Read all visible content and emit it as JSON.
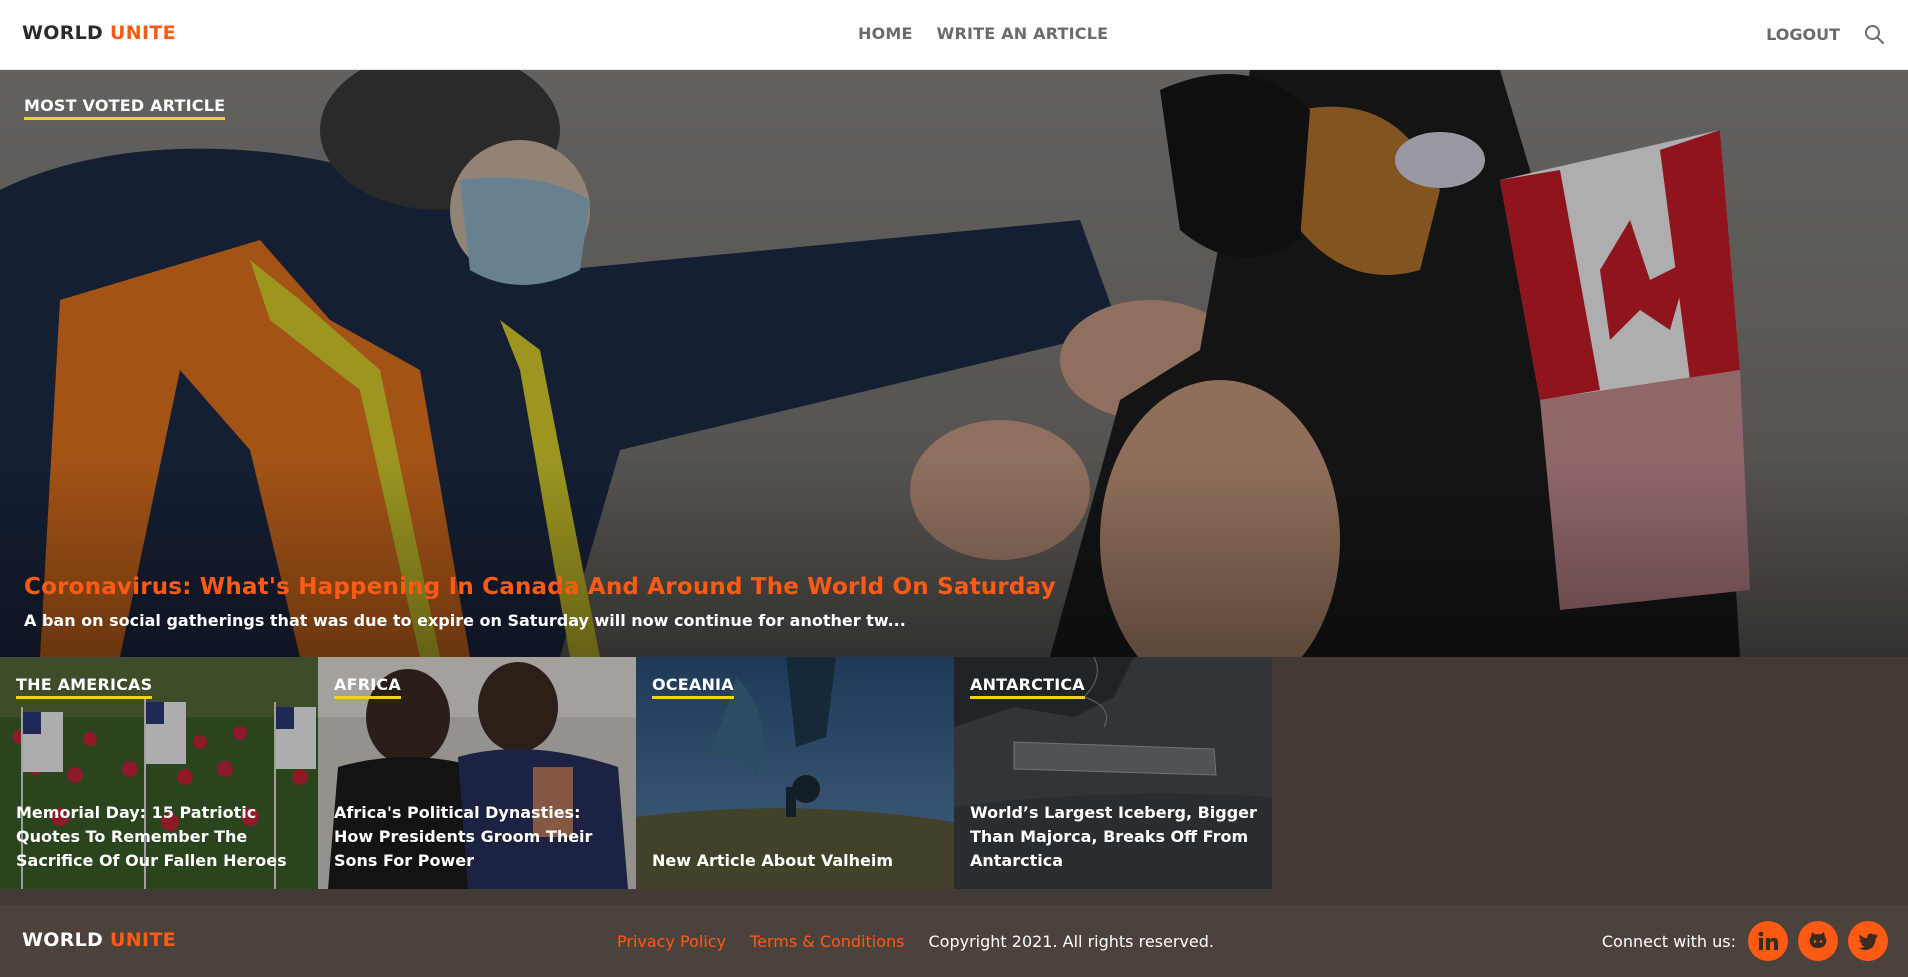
{
  "header": {
    "brand_part1": "WORLD",
    "brand_part2": "UNITE",
    "nav": [
      "HOME",
      "WRITE AN ARTICLE"
    ],
    "logout_label": "LOGOUT",
    "search_icon": "search-icon"
  },
  "hero": {
    "section_label": "MOST VOTED ARTICLE",
    "title": "Coronavirus: What's Happening In Canada And Around The World On Saturday",
    "excerpt": "A ban on social gatherings that was due to expire on Saturday will now continue for another tw..."
  },
  "regions": [
    {
      "category": "THE AMERICAS",
      "title": "Memorial Day: 15 Patriotic Quotes To Remember The Sacrifice Of Our Fallen Heroes"
    },
    {
      "category": "AFRICA",
      "title": "Africa's Political Dynasties: How Presidents Groom Their Sons For Power"
    },
    {
      "category": "OCEANIA",
      "title": "New Article About Valheim"
    },
    {
      "category": "ANTARCTICA",
      "title": "World’s Largest Iceberg, Bigger Than Majorca, Breaks Off From Antarctica"
    }
  ],
  "footer": {
    "brand_part1": "WORLD",
    "brand_part2": "UNITE",
    "privacy_label": "Privacy Policy",
    "terms_label": "Terms & Conditions",
    "copyright": "Copyright 2021. All rights reserved.",
    "connect_label": "Connect with us:",
    "social_icons": [
      "linkedin-icon",
      "github-icon",
      "twitter-icon"
    ]
  },
  "colors": {
    "accent": "#ff5a14",
    "tag_underline": "#f2d21a",
    "strip_bg": "#413a35",
    "footer_bg": "#4b423c"
  }
}
